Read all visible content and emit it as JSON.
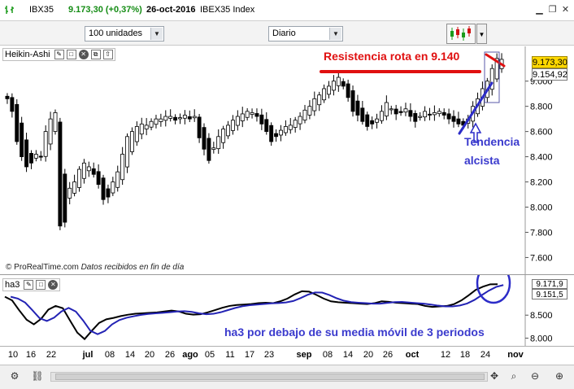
{
  "window": {
    "symbol": "IBX35",
    "price_change": "9.173,30 (+0,37%)",
    "date": "26-oct-2016",
    "instrument": "IBEX35 Index"
  },
  "toolbar": {
    "quantity_value": "100 unidades",
    "period_value": "Diario"
  },
  "main_panel": {
    "label": "Heikin-Ashi",
    "last_price": "9.173,30",
    "ref_price": "9.154,92",
    "copyright": "© ProRealTime.com",
    "data_note": "Datos recibidos en fin de día"
  },
  "y_axis_main": [
    "9.000",
    "8.800",
    "8.600",
    "8.400",
    "8.200",
    "8.000",
    "7.800",
    "7.600"
  ],
  "annotations": {
    "resistance": "Resistencia rota en 9.140",
    "trend_line1": "Tendencia",
    "trend_line2": "alcista",
    "indicator_note": "ha3 por debajo de su media móvil de 3 periodos"
  },
  "indicator_panel": {
    "label": "ha3",
    "value_top": "9.171,9",
    "value_bottom": "9.151,5"
  },
  "y_axis_ind": [
    "8.500",
    "8.000"
  ],
  "x_axis": [
    {
      "label": "10",
      "month": false
    },
    {
      "label": "16",
      "month": false
    },
    {
      "label": "22",
      "month": false
    },
    {
      "label": "jul",
      "month": true
    },
    {
      "label": "08",
      "month": false
    },
    {
      "label": "14",
      "month": false
    },
    {
      "label": "20",
      "month": false
    },
    {
      "label": "26",
      "month": false
    },
    {
      "label": "ago",
      "month": true
    },
    {
      "label": "05",
      "month": false
    },
    {
      "label": "11",
      "month": false
    },
    {
      "label": "17",
      "month": false
    },
    {
      "label": "23",
      "month": false
    },
    {
      "label": "sep",
      "month": true
    },
    {
      "label": "08",
      "month": false
    },
    {
      "label": "14",
      "month": false
    },
    {
      "label": "20",
      "month": false
    },
    {
      "label": "26",
      "month": false
    },
    {
      "label": "oct",
      "month": true
    },
    {
      "label": "12",
      "month": false
    },
    {
      "label": "18",
      "month": false
    },
    {
      "label": "24",
      "month": false
    },
    {
      "label": "nov",
      "month": true
    }
  ],
  "colors": {
    "bull": "#ffffff",
    "bear": "#000000",
    "resistance": "#e01010",
    "trend": "#2c2cc8",
    "annotation_text": "#3a3acd",
    "ind_line": "#000000",
    "ind_ma": "#2323b4",
    "price_tag": "#ffd800"
  },
  "chart_data": {
    "type": "candlestick",
    "title": "",
    "ylim": [
      7480,
      9250
    ],
    "closes": [
      8860,
      8760,
      8520,
      8400,
      8320,
      8350,
      8420,
      8400,
      8600,
      8700,
      8750,
      7850,
      7880,
      8150,
      8200,
      8300,
      8350,
      8320,
      8260,
      8180,
      8060,
      8080,
      8200,
      8280,
      8420,
      8560,
      8600,
      8640,
      8660,
      8650,
      8680,
      8700,
      8700,
      8720,
      8720,
      8690,
      8710,
      8730,
      8700,
      8720,
      8550,
      8460,
      8370,
      8470,
      8560,
      8620,
      8650,
      8690,
      8720,
      8740,
      8760,
      8750,
      8720,
      8660,
      8600,
      8520,
      8560,
      8610,
      8640,
      8650,
      8690,
      8720,
      8770,
      8800,
      8860,
      8890,
      8940,
      8960,
      9000,
      9030,
      8960,
      8870,
      8760,
      8730,
      8680,
      8640,
      8660,
      8700,
      8760,
      8830,
      8780,
      8740,
      8750,
      8780,
      8720,
      8680,
      8720,
      8760,
      8730,
      8750,
      8760,
      8730,
      8700,
      8680,
      8660,
      8650,
      8700,
      8800,
      8860,
      8940,
      9000,
      9100,
      9180,
      9173
    ],
    "ind_values": [
      8900,
      8820,
      8600,
      8400,
      8300,
      8420,
      8620,
      8700,
      8650,
      8380,
      8120,
      7980,
      8160,
      8330,
      8410,
      8440,
      8480,
      8510,
      8530,
      8540,
      8550,
      8560,
      8580,
      8600,
      8580,
      8530,
      8510,
      8520,
      8560,
      8610,
      8660,
      8700,
      8720,
      8730,
      8740,
      8760,
      8770,
      8760,
      8800,
      8860,
      8950,
      9020,
      9010,
      8940,
      8860,
      8800,
      8780,
      8770,
      8760,
      8750,
      8740,
      8760,
      8800,
      8790,
      8770,
      8760,
      8750,
      8740,
      8700,
      8680,
      8690,
      8700,
      8740,
      8820,
      8930,
      9050,
      9120,
      9170,
      9172
    ],
    "ind_ylim": [
      7850,
      9300
    ]
  }
}
